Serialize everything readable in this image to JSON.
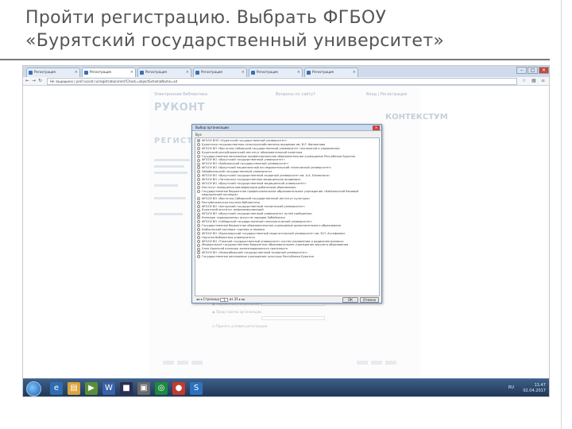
{
  "slide": {
    "title_line1": "Пройти регистрацию. Выбрать ФГБОУ",
    "title_line2": "«Бурятский государственный университет»"
  },
  "browser": {
    "tabs": [
      {
        "label": "Регистрация",
        "active": false
      },
      {
        "label": "Регистрация",
        "active": true
      },
      {
        "label": "Регистрация",
        "active": false
      },
      {
        "label": "Регистрация",
        "active": false
      },
      {
        "label": "Регистрация",
        "active": false
      },
      {
        "label": "Регистрация",
        "active": false
      }
    ],
    "window_buttons": {
      "minimize": "–",
      "maximize": "□",
      "close": "✕"
    },
    "url": "Не защищено | prof.rucont.ru/registration/rent?Check=objectSchemaName=sd"
  },
  "page": {
    "nav_left": "Электронная библиотека",
    "nav_mid": "Вопросы по сайту?",
    "nav_right": "Вход | Регистрация",
    "logo_left": "РУКОНТ",
    "logo_right": "КОНТЕКСТУМ",
    "heading": "РЕГИСТРАЦИЯ",
    "form_rows": [
      "Я согласен на обработку персональных данных",
      "Я согласен с условиями пользовательского соглашения",
      "Подписаться на рассылку новостей",
      "Представляю организацию",
      "Принять условия регистрации"
    ]
  },
  "dialog": {
    "title": "Выбор организации",
    "close": "✕",
    "label": "Вуз:",
    "options": [
      {
        "text": "ФГБОУ ВПО «Бурятский государственный университет»",
        "selected": true
      },
      {
        "text": "Бурятская государственная сельскохозяйственная академия им. В.Р. Филиппова",
        "selected": false
      },
      {
        "text": "ФГБОУ ВО «Восточно-Сибирский государственный университет технологий и управления»",
        "selected": false
      },
      {
        "text": "Бурятский республиканский институт образовательной политики",
        "selected": false
      },
      {
        "text": "Государственное автономное профессиональное образовательное учреждение Республики Бурятия",
        "selected": false
      },
      {
        "text": "ФГБОУ ВО «Иркутский государственный университет»",
        "selected": false
      },
      {
        "text": "ФГБОУ ВО «Байкальский государственный университет»",
        "selected": false
      },
      {
        "text": "ФГБОУ ВО «Иркутский национальный исследовательский технический университет»",
        "selected": false
      },
      {
        "text": "Забайкальский государственный университет",
        "selected": false
      },
      {
        "text": "ФГБОУ ВО «Иркутский государственный аграрный университет им. А.А. Ежевского»",
        "selected": false
      },
      {
        "text": "ФГБОУ ВО «Читинская государственная медицинская академия»",
        "selected": false
      },
      {
        "text": "ФГБОУ ВО «Иркутский государственный медицинский университет»",
        "selected": false
      },
      {
        "text": "Институт повышения квалификации работников образования",
        "selected": false
      },
      {
        "text": "Государственное бюджетное профессиональное образовательное учреждение «Байкальский базовый медицинский колледж»",
        "selected": false
      },
      {
        "text": "ФГБОУ ВО «Восточно-Сибирский государственный институт культуры»",
        "selected": false
      },
      {
        "text": "Республиканская научная библиотека",
        "selected": false
      },
      {
        "text": "ФГБОУ ВО «Ангарский государственный технический университет»",
        "selected": false
      },
      {
        "text": "Бурятский институт инфокоммуникаций",
        "selected": false
      },
      {
        "text": "ФГБОУ ВО «Иркутский государственный университет путей сообщения»",
        "selected": false
      },
      {
        "text": "Колледж традиционных искусств народов Забайкалья",
        "selected": false
      },
      {
        "text": "ФГБОУ ВО «Сибирский государственный технологический университет»",
        "selected": false
      },
      {
        "text": "Государственное бюджетное образовательное учреждение дополнительного образования",
        "selected": false
      },
      {
        "text": "Байкальский колледж туризма и сервиса",
        "selected": false
      },
      {
        "text": "ФГБОУ ВО «Красноярский государственный педагогический университет им. В.П. Астафьева»",
        "selected": false
      },
      {
        "text": "Научная библиотека университета",
        "selected": false
      },
      {
        "text": "ФГБОУ ВО «Томский государственный университет систем управления и радиоэлектроники»",
        "selected": false
      },
      {
        "text": "Федеральное государственное бюджетное образовательное учреждение высшего образования",
        "selected": false
      },
      {
        "text": "Улан-Удэнский колледж железнодорожного транспорта",
        "selected": false
      },
      {
        "text": "ФГБОУ ВО «Новосибирский государственный аграрный университет»",
        "selected": false
      },
      {
        "text": "Государственное автономное учреждение культуры Республики Бурятия",
        "selected": false
      }
    ],
    "pager_label": "Страница",
    "pager_value": "1",
    "pager_total": "из 35",
    "ok_label": "ОК",
    "cancel_label": "Отмена"
  },
  "taskbar": {
    "language": "RU",
    "time": "11:47",
    "date": "02.04.2017"
  }
}
